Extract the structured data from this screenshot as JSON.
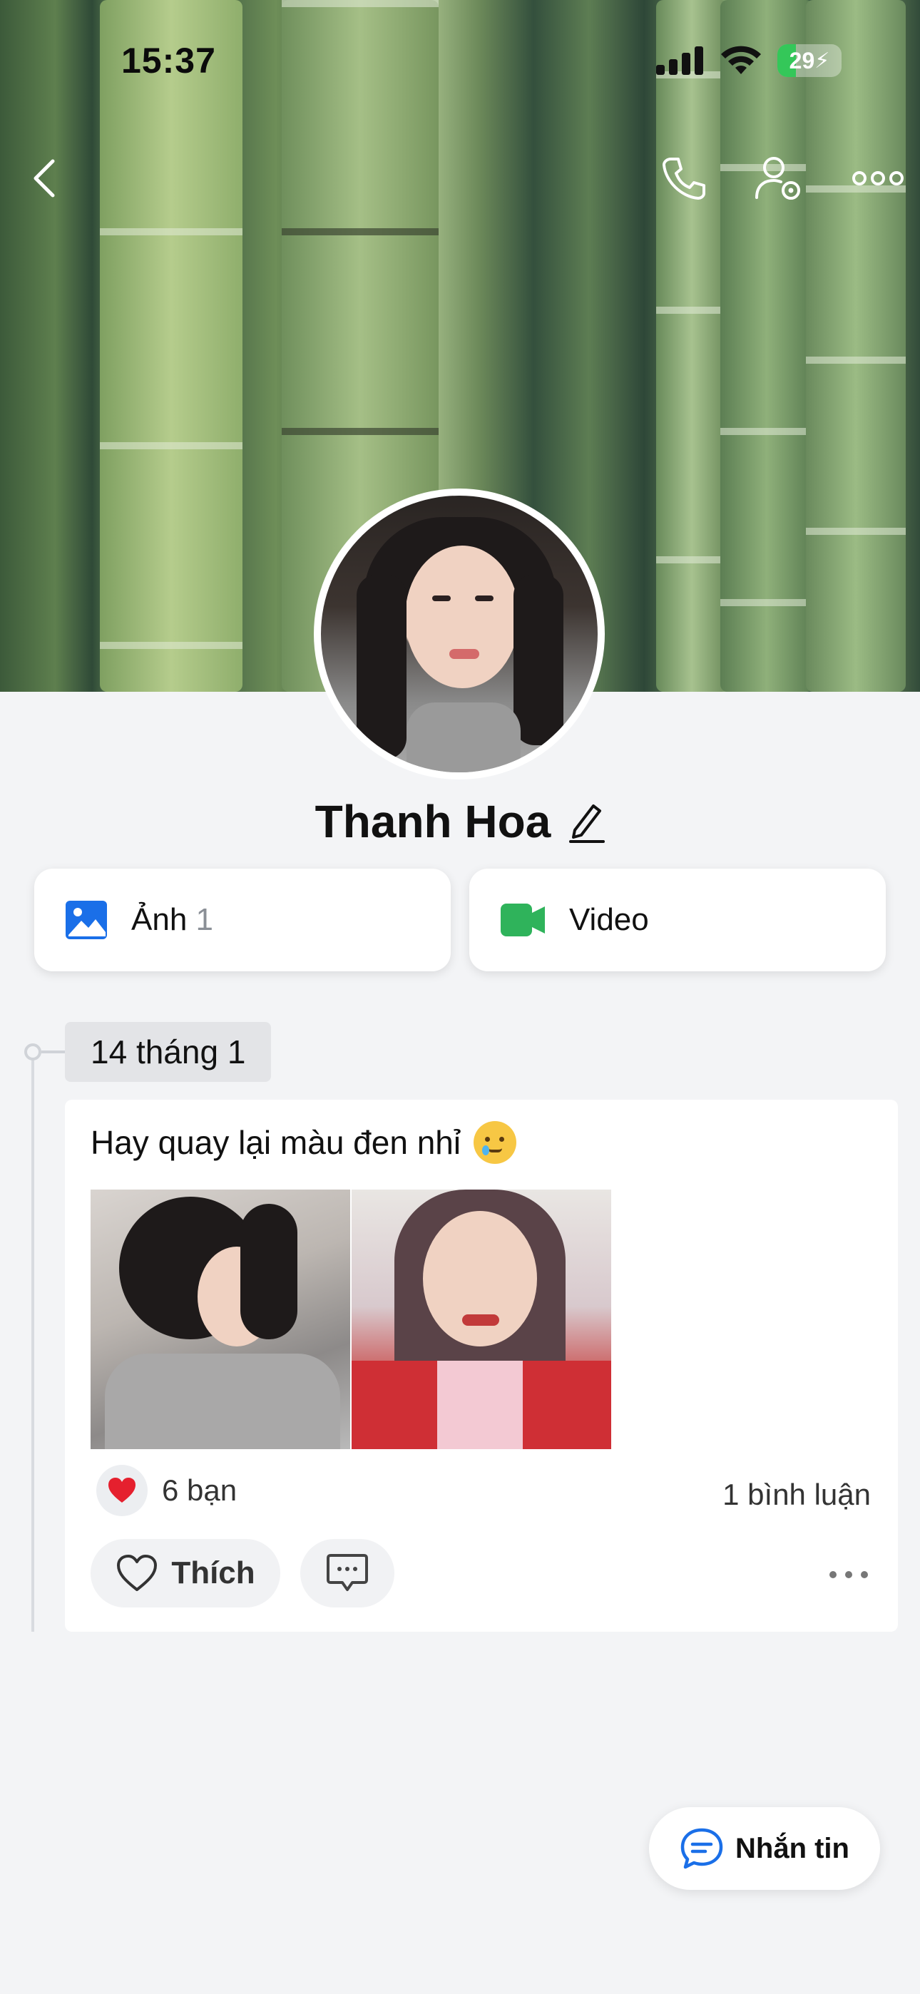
{
  "status_bar": {
    "time": "15:37",
    "battery_level": "29"
  },
  "nav": {
    "back_icon": "chevron-left-icon",
    "call_icon": "phone-icon",
    "settings_icon": "user-settings-icon",
    "more_icon": "more-horizontal-icon"
  },
  "profile": {
    "name": "Thanh Hoa",
    "edit_icon": "pencil-icon"
  },
  "media": {
    "photos_label": "Ảnh",
    "photos_count": "1",
    "video_label": "Video"
  },
  "timeline": {
    "date": "14 tháng 1"
  },
  "post": {
    "text": "Hay quay lại màu đen nhỉ",
    "emoji": "smiling-face-with-tear",
    "reaction_count": "6 bạn",
    "comment_count": "1 bình luận",
    "like_label": "Thích"
  },
  "message_button": {
    "label": "Nhắn tin"
  },
  "colors": {
    "accent_blue": "#1a6fe8",
    "video_green": "#2fb35b",
    "heart_red": "#e5202e",
    "background": "#f3f4f6"
  }
}
